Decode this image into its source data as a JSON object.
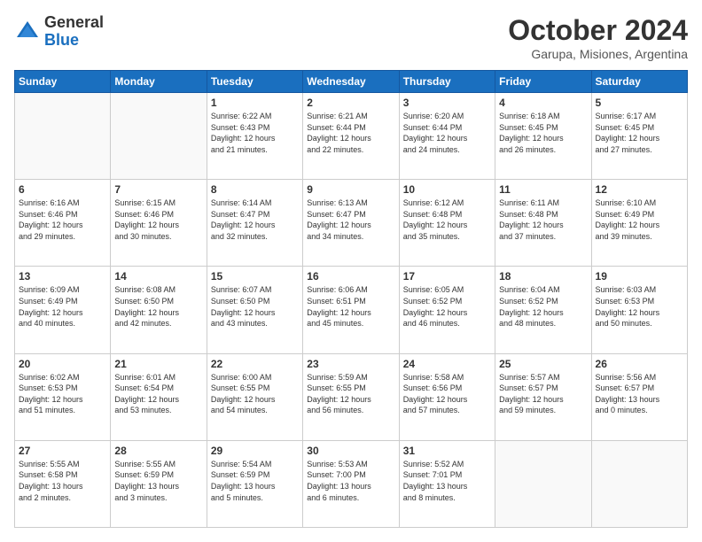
{
  "header": {
    "logo_general": "General",
    "logo_blue": "Blue",
    "month_title": "October 2024",
    "location": "Garupa, Misiones, Argentina"
  },
  "columns": [
    "Sunday",
    "Monday",
    "Tuesday",
    "Wednesday",
    "Thursday",
    "Friday",
    "Saturday"
  ],
  "weeks": [
    {
      "alt": false,
      "days": [
        {
          "num": "",
          "info": ""
        },
        {
          "num": "",
          "info": ""
        },
        {
          "num": "1",
          "info": "Sunrise: 6:22 AM\nSunset: 6:43 PM\nDaylight: 12 hours\nand 21 minutes."
        },
        {
          "num": "2",
          "info": "Sunrise: 6:21 AM\nSunset: 6:44 PM\nDaylight: 12 hours\nand 22 minutes."
        },
        {
          "num": "3",
          "info": "Sunrise: 6:20 AM\nSunset: 6:44 PM\nDaylight: 12 hours\nand 24 minutes."
        },
        {
          "num": "4",
          "info": "Sunrise: 6:18 AM\nSunset: 6:45 PM\nDaylight: 12 hours\nand 26 minutes."
        },
        {
          "num": "5",
          "info": "Sunrise: 6:17 AM\nSunset: 6:45 PM\nDaylight: 12 hours\nand 27 minutes."
        }
      ]
    },
    {
      "alt": true,
      "days": [
        {
          "num": "6",
          "info": "Sunrise: 6:16 AM\nSunset: 6:46 PM\nDaylight: 12 hours\nand 29 minutes."
        },
        {
          "num": "7",
          "info": "Sunrise: 6:15 AM\nSunset: 6:46 PM\nDaylight: 12 hours\nand 30 minutes."
        },
        {
          "num": "8",
          "info": "Sunrise: 6:14 AM\nSunset: 6:47 PM\nDaylight: 12 hours\nand 32 minutes."
        },
        {
          "num": "9",
          "info": "Sunrise: 6:13 AM\nSunset: 6:47 PM\nDaylight: 12 hours\nand 34 minutes."
        },
        {
          "num": "10",
          "info": "Sunrise: 6:12 AM\nSunset: 6:48 PM\nDaylight: 12 hours\nand 35 minutes."
        },
        {
          "num": "11",
          "info": "Sunrise: 6:11 AM\nSunset: 6:48 PM\nDaylight: 12 hours\nand 37 minutes."
        },
        {
          "num": "12",
          "info": "Sunrise: 6:10 AM\nSunset: 6:49 PM\nDaylight: 12 hours\nand 39 minutes."
        }
      ]
    },
    {
      "alt": false,
      "days": [
        {
          "num": "13",
          "info": "Sunrise: 6:09 AM\nSunset: 6:49 PM\nDaylight: 12 hours\nand 40 minutes."
        },
        {
          "num": "14",
          "info": "Sunrise: 6:08 AM\nSunset: 6:50 PM\nDaylight: 12 hours\nand 42 minutes."
        },
        {
          "num": "15",
          "info": "Sunrise: 6:07 AM\nSunset: 6:50 PM\nDaylight: 12 hours\nand 43 minutes."
        },
        {
          "num": "16",
          "info": "Sunrise: 6:06 AM\nSunset: 6:51 PM\nDaylight: 12 hours\nand 45 minutes."
        },
        {
          "num": "17",
          "info": "Sunrise: 6:05 AM\nSunset: 6:52 PM\nDaylight: 12 hours\nand 46 minutes."
        },
        {
          "num": "18",
          "info": "Sunrise: 6:04 AM\nSunset: 6:52 PM\nDaylight: 12 hours\nand 48 minutes."
        },
        {
          "num": "19",
          "info": "Sunrise: 6:03 AM\nSunset: 6:53 PM\nDaylight: 12 hours\nand 50 minutes."
        }
      ]
    },
    {
      "alt": true,
      "days": [
        {
          "num": "20",
          "info": "Sunrise: 6:02 AM\nSunset: 6:53 PM\nDaylight: 12 hours\nand 51 minutes."
        },
        {
          "num": "21",
          "info": "Sunrise: 6:01 AM\nSunset: 6:54 PM\nDaylight: 12 hours\nand 53 minutes."
        },
        {
          "num": "22",
          "info": "Sunrise: 6:00 AM\nSunset: 6:55 PM\nDaylight: 12 hours\nand 54 minutes."
        },
        {
          "num": "23",
          "info": "Sunrise: 5:59 AM\nSunset: 6:55 PM\nDaylight: 12 hours\nand 56 minutes."
        },
        {
          "num": "24",
          "info": "Sunrise: 5:58 AM\nSunset: 6:56 PM\nDaylight: 12 hours\nand 57 minutes."
        },
        {
          "num": "25",
          "info": "Sunrise: 5:57 AM\nSunset: 6:57 PM\nDaylight: 12 hours\nand 59 minutes."
        },
        {
          "num": "26",
          "info": "Sunrise: 5:56 AM\nSunset: 6:57 PM\nDaylight: 13 hours\nand 0 minutes."
        }
      ]
    },
    {
      "alt": false,
      "days": [
        {
          "num": "27",
          "info": "Sunrise: 5:55 AM\nSunset: 6:58 PM\nDaylight: 13 hours\nand 2 minutes."
        },
        {
          "num": "28",
          "info": "Sunrise: 5:55 AM\nSunset: 6:59 PM\nDaylight: 13 hours\nand 3 minutes."
        },
        {
          "num": "29",
          "info": "Sunrise: 5:54 AM\nSunset: 6:59 PM\nDaylight: 13 hours\nand 5 minutes."
        },
        {
          "num": "30",
          "info": "Sunrise: 5:53 AM\nSunset: 7:00 PM\nDaylight: 13 hours\nand 6 minutes."
        },
        {
          "num": "31",
          "info": "Sunrise: 5:52 AM\nSunset: 7:01 PM\nDaylight: 13 hours\nand 8 minutes."
        },
        {
          "num": "",
          "info": ""
        },
        {
          "num": "",
          "info": ""
        }
      ]
    }
  ]
}
